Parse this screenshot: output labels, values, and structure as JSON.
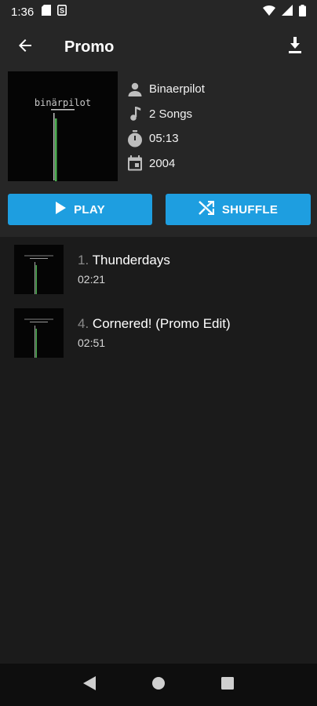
{
  "status_bar": {
    "time": "1:36",
    "left_icons": [
      "sd-card-icon",
      "s-notification-icon"
    ],
    "right_icons": [
      "wifi-icon",
      "signal-icon",
      "battery-icon"
    ]
  },
  "app_bar": {
    "title": "Promo",
    "back_icon": "arrow-back-icon",
    "download_icon": "download-icon"
  },
  "album": {
    "art_text": "binärpilot",
    "artist": "Binaerpilot",
    "songs": "2 Songs",
    "duration": "05:13",
    "year": "2004"
  },
  "buttons": {
    "play_label": "PLAY",
    "shuffle_label": "SHUFFLE"
  },
  "tracks": [
    {
      "number": "1.",
      "title": "Thunderdays",
      "duration": "02:21"
    },
    {
      "number": "4.",
      "title": "Cornered! (Promo Edit)",
      "duration": "02:51"
    }
  ],
  "colors": {
    "accent": "#1e9ee0",
    "background": "#1b1b1b",
    "header": "#262626",
    "nav_bar": "#0e0e0e",
    "art_line": "#4caf50"
  }
}
